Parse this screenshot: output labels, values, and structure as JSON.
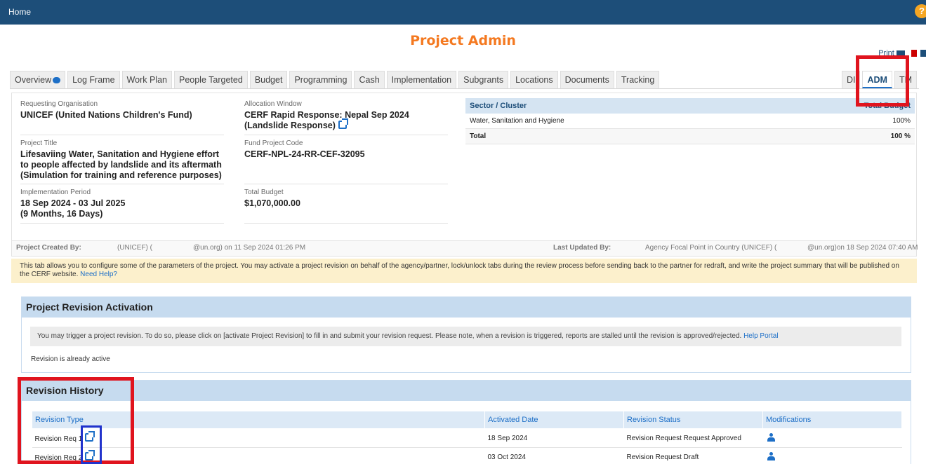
{
  "topbar": {
    "home_label": "Home",
    "help_label": "?"
  },
  "page_title": "Project Admin",
  "print": {
    "label": "Print"
  },
  "tabs": {
    "left": [
      "Overview",
      "Log Frame",
      "Work Plan",
      "People Targeted",
      "Budget",
      "Programming",
      "Cash",
      "Implementation",
      "Subgrants",
      "Locations",
      "Documents",
      "Tracking"
    ],
    "right": [
      "DI",
      "ADM",
      "TM"
    ],
    "active": "ADM"
  },
  "project": {
    "requesting_org_label": "Requesting Organisation",
    "requesting_org": "UNICEF (United Nations Children's Fund)",
    "allocation_window_label": "Allocation Window",
    "allocation_window": "CERF Rapid Response: Nepal Sep 2024 (Landslide Response)",
    "project_title_label": "Project Title",
    "project_title": "Lifesaviing Water, Sanitation and Hygiene effort to people affected by landslide and its aftermath (Simulation for training and reference purposes)",
    "fund_code_label": "Fund Project Code",
    "fund_code": "CERF-NPL-24-RR-CEF-32095",
    "impl_period_label": "Implementation Period",
    "impl_period": "18 Sep 2024 - 03 Jul 2025",
    "impl_duration": "(9 Months, 16 Days)",
    "total_budget_label": "Total Budget",
    "total_budget": "$1,070,000.00"
  },
  "sector": {
    "header": "Sector / Cluster",
    "header_right": "Total Budget",
    "rows": [
      {
        "name": "Water, Sanitation and Hygiene",
        "pct": "100%"
      }
    ],
    "total_label": "Total",
    "total_pct": "100 %"
  },
  "meta": {
    "created_by_label": "Project Created By:",
    "created_by_org": "(UNICEF) (",
    "created_by_email": "@un.org) on 11 Sep 2024 01:26 PM",
    "updated_by_label": "Last Updated By:",
    "updated_by_name": "Agency Focal Point in Country (UNICEF) (",
    "updated_by_email": "@un.org)on 18 Sep 2024 07:40 AM"
  },
  "notice": {
    "text": "This tab allows you to configure some of the parameters of the project. You may activate a project revision on behalf of the agency/partner, lock/unlock tabs during the review process before sending back to the partner for redraft, and write the project summary that will be published on the CERF website.",
    "link": "Need Help?"
  },
  "revision_activation": {
    "title": "Project Revision Activation",
    "note": "You may trigger a project revision. To do so, please click on [activate Project Revision] to fill in and submit your revision request. Please note, when a revision is triggered, reports are stalled until the revision is approved/rejected.",
    "note_link": "Help Portal",
    "status_text": "Revision is already active"
  },
  "revision_history": {
    "title": "Revision History",
    "columns": [
      "Revision Type",
      "Activated Date",
      "Revision Status",
      "Modifications"
    ],
    "rows": [
      {
        "type": "Revision Req 1",
        "date": "18 Sep 2024",
        "status": "Revision Request Request Approved"
      },
      {
        "type": "Revision Req 2",
        "date": "03 Oct 2024",
        "status": "Revision Request Draft"
      }
    ]
  },
  "colors": {
    "topbar": "#1d4e79",
    "title": "#f47920",
    "link": "#1d6fc7",
    "highlight_red": "#e0141e",
    "highlight_blue": "#2233cc"
  }
}
